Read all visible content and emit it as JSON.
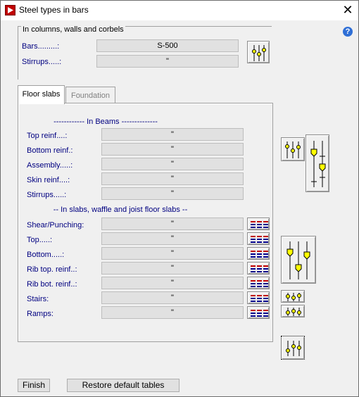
{
  "window": {
    "title": "Steel types in bars",
    "close_glyph": "✕",
    "help_glyph": "?"
  },
  "columns_group": {
    "title": "In columns, walls and corbels",
    "rows": [
      {
        "label": "Bars.........:",
        "value": "S-500"
      },
      {
        "label": "Stirrups.....:",
        "value": "\""
      }
    ]
  },
  "tabs": [
    {
      "label": "Floor slabs",
      "active": true
    },
    {
      "label": "Foundation",
      "active": false
    }
  ],
  "beams_section": {
    "title": "------------ In Beams --------------",
    "rows": [
      {
        "label": "Top reinf....:",
        "value": "\""
      },
      {
        "label": "Bottom reinf.:",
        "value": "\""
      },
      {
        "label": "Assembly.....:",
        "value": "\""
      },
      {
        "label": "Skin reinf....:",
        "value": "\""
      },
      {
        "label": "Stirrups.....:",
        "value": "\""
      }
    ]
  },
  "slabs_section": {
    "title": "-- In slabs, waffle and joist floor slabs --",
    "rows": [
      {
        "label": "Shear/Punching:",
        "value": "\""
      },
      {
        "label": "Top.....:",
        "value": "\""
      },
      {
        "label": "Bottom.....:",
        "value": "\""
      },
      {
        "label": "Rib top. reinf..:",
        "value": "\""
      },
      {
        "label": "Rib bot. reinf..:",
        "value": "\""
      },
      {
        "label": "Stairs:",
        "value": "\""
      },
      {
        "label": "Ramps:",
        "value": "\""
      }
    ]
  },
  "buttons": {
    "finish": "Finish",
    "restore": "Restore default tables"
  },
  "icons": {
    "app": "app-play-icon",
    "slider_buttons": "sliders-icon",
    "table_buttons": "table-grid-icon",
    "help": "help-icon"
  },
  "colors": {
    "label_text": "#000080",
    "slider_knob": "#ffff00",
    "grid_lines": "#00008b",
    "grid_accent": "#c00000"
  }
}
